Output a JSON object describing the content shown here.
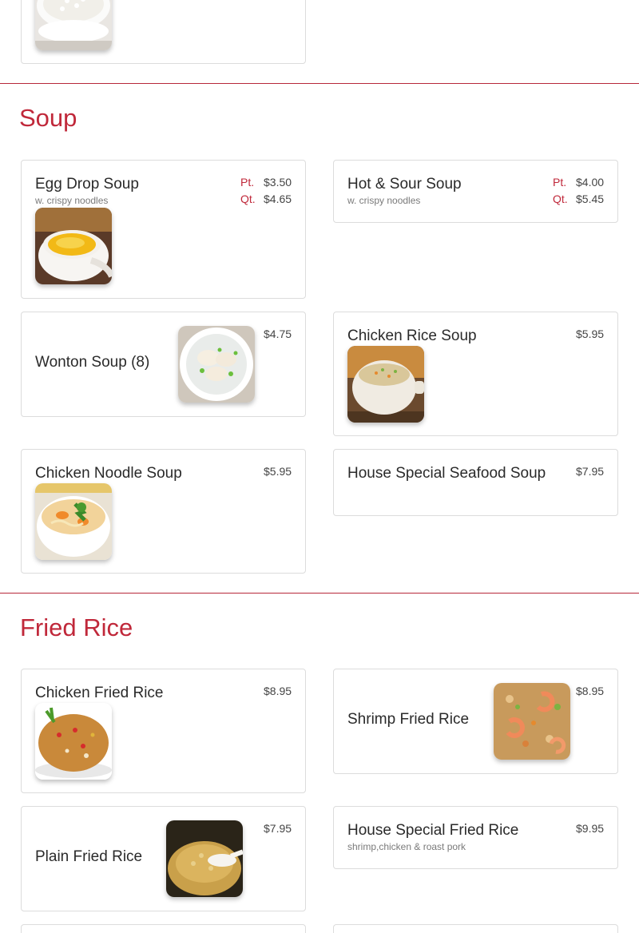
{
  "colors": {
    "accent": "#c0283a",
    "card_border": "#dcdcdc",
    "text": "#2a2a2a",
    "desc": "#7a7a7a"
  },
  "sections": {
    "soup": {
      "title": "Soup",
      "items": {
        "egg_drop": {
          "name": "Egg Drop Soup",
          "desc": "w. crispy noodles",
          "pt_label": "Pt.",
          "pt_price": "$3.50",
          "qt_label": "Qt.",
          "qt_price": "$4.65",
          "image": "egg-drop-soup-photo"
        },
        "hot_sour": {
          "name": "Hot & Sour Soup",
          "desc": "w. crispy noodles",
          "pt_label": "Pt.",
          "pt_price": "$4.00",
          "qt_label": "Qt.",
          "qt_price": "$5.45"
        },
        "wonton": {
          "name": "Wonton Soup (8)",
          "price": "$4.75",
          "image": "wonton-soup-photo"
        },
        "chicken_rice": {
          "name": "Chicken Rice Soup",
          "price": "$5.95",
          "image": "chicken-rice-soup-photo"
        },
        "chicken_noodle": {
          "name": "Chicken Noodle Soup",
          "price": "$5.95",
          "image": "chicken-noodle-soup-photo"
        },
        "house_seafood": {
          "name": "House Special Seafood Soup",
          "price": "$7.95"
        }
      }
    },
    "fried_rice": {
      "title": "Fried Rice",
      "items": {
        "chicken": {
          "name": "Chicken Fried Rice",
          "price": "$8.95",
          "image": "chicken-fried-rice-photo"
        },
        "shrimp": {
          "name": "Shrimp Fried Rice",
          "price": "$8.95",
          "image": "shrimp-fried-rice-photo"
        },
        "plain": {
          "name": "Plain Fried Rice",
          "price": "$7.95",
          "image": "plain-fried-rice-photo"
        },
        "house_special": {
          "name": "House Special Fried Rice",
          "desc": "shrimp,chicken & roast pork",
          "price": "$9.95"
        }
      }
    }
  }
}
